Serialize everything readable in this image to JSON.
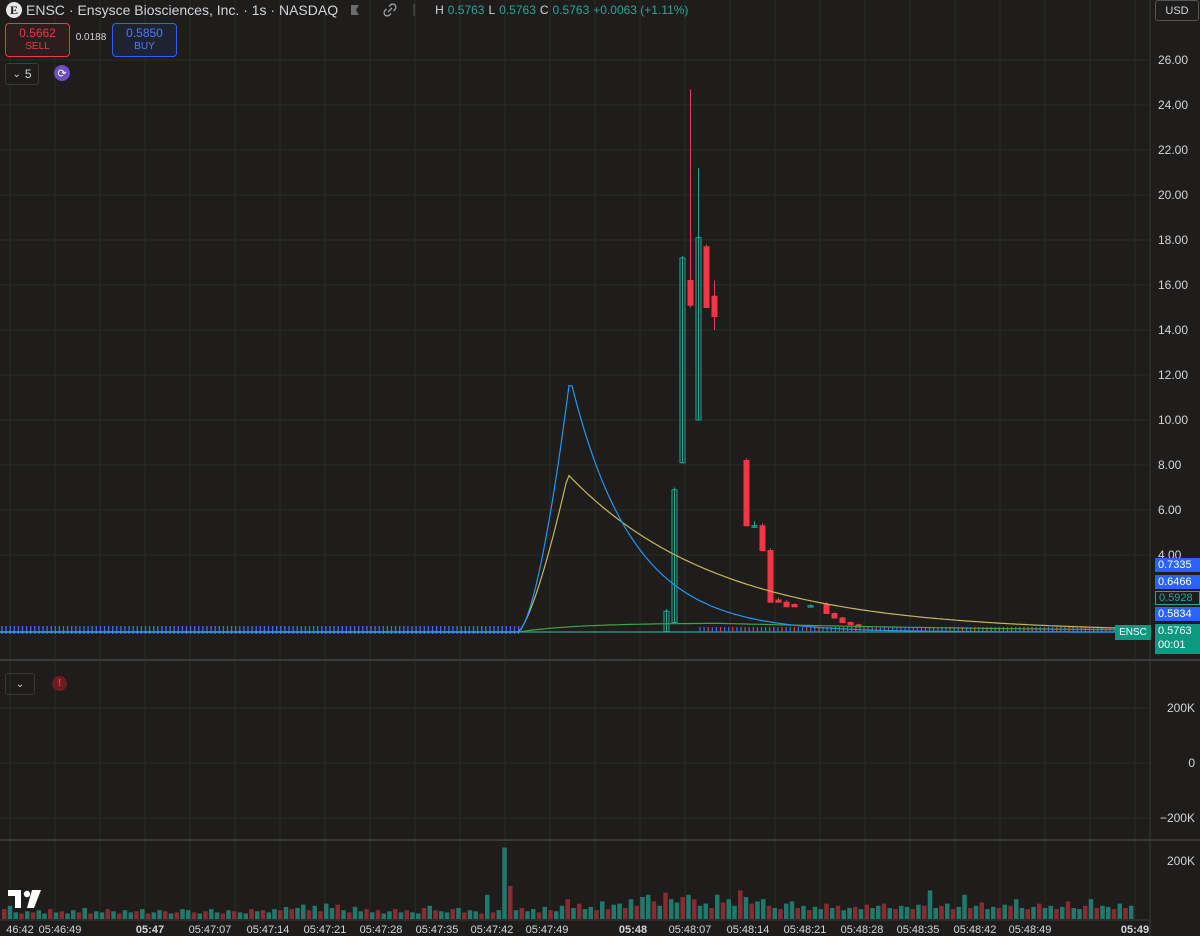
{
  "header": {
    "logo_letter": "E",
    "symbol": "ENSC",
    "title": "· Ensysce Biosciences, Inc. · 1s · NASDAQ",
    "ohlc": {
      "h_label": "H",
      "h": "0.5763",
      "l_label": "L",
      "l": "0.5763",
      "c_label": "C",
      "c": "0.5763",
      "change": "+0.0063 (+1.11%)"
    },
    "link_icon": "link-icon"
  },
  "trade": {
    "sell_price": "0.5662",
    "sell_label": "SELL",
    "spread": "0.0188",
    "buy_price": "0.5850",
    "buy_label": "BUY"
  },
  "interval": {
    "label": "5",
    "chevron": "⌄"
  },
  "currency": "USD",
  "price_axis": {
    "ticks": [
      "26.00",
      "24.00",
      "22.00",
      "20.00",
      "18.00",
      "16.00",
      "14.00",
      "12.00",
      "10.00",
      "8.00",
      "6.00",
      "4.00"
    ]
  },
  "price_tags": [
    {
      "value": "0.7335",
      "color": "#2962ff"
    },
    {
      "value": "0.6466",
      "color": "#2962ff"
    },
    {
      "value": "0.5928",
      "color": "#1e1d1b"
    },
    {
      "value": "0.5834",
      "color": "#2962ff"
    }
  ],
  "last_tag": {
    "symbol": "ENSC",
    "price": "0.5763",
    "countdown": "00:01"
  },
  "indicator_axis": {
    "ticks": [
      "200K",
      "0",
      "−200K"
    ]
  },
  "volume_axis": {
    "ticks": [
      "200K"
    ]
  },
  "time_axis": {
    "ticks": [
      "46:42",
      "05:46:49",
      "05:47",
      "05:47:07",
      "05:47:14",
      "05:47:21",
      "05:47:28",
      "05:47:35",
      "05:47:42",
      "05:47:49",
      "05:48",
      "05:48:07",
      "05:48:14",
      "05:48:21",
      "05:48:28",
      "05:48:35",
      "05:48:42",
      "05:48:49",
      "05:49"
    ]
  },
  "colors": {
    "up": "#26a69a",
    "down": "#f23645",
    "ma_blue": "#2196f3",
    "ma_yellow": "#c9b458",
    "ma_green": "#43a047"
  },
  "chart_data": {
    "type": "candlestick",
    "candles": [
      {
        "t": "05:47:44",
        "o": 0.6,
        "h": 1.6,
        "l": 0.58,
        "c": 1.5
      },
      {
        "t": "05:47:45",
        "o": 1.0,
        "h": 7.0,
        "l": 1.0,
        "c": 6.9
      },
      {
        "t": "05:47:46",
        "o": 8.1,
        "h": 17.3,
        "l": 8.1,
        "c": 17.2
      },
      {
        "t": "05:47:47",
        "o": 16.2,
        "h": 24.7,
        "l": 15.0,
        "c": 15.1
      },
      {
        "t": "05:47:48",
        "o": 10.0,
        "h": 21.2,
        "l": 10.0,
        "c": 18.1
      },
      {
        "t": "05:47:49",
        "o": 17.7,
        "h": 17.8,
        "l": 15.0,
        "c": 15.0
      },
      {
        "t": "05:47:50",
        "o": 15.5,
        "h": 16.2,
        "l": 14.0,
        "c": 14.6
      },
      {
        "t": "05:47:54",
        "o": 8.2,
        "h": 8.3,
        "l": 5.3,
        "c": 5.3
      },
      {
        "t": "05:47:55",
        "o": 5.3,
        "h": 5.5,
        "l": 5.2,
        "c": 5.3
      },
      {
        "t": "05:47:56",
        "o": 5.3,
        "h": 5.4,
        "l": 4.2,
        "c": 4.2
      },
      {
        "t": "05:47:57",
        "o": 4.2,
        "h": 4.3,
        "l": 1.9,
        "c": 1.9
      },
      {
        "t": "05:47:58",
        "o": 2.0,
        "h": 2.1,
        "l": 1.9,
        "c": 1.9
      },
      {
        "t": "05:47:59",
        "o": 1.9,
        "h": 2.0,
        "l": 1.7,
        "c": 1.7
      },
      {
        "t": "05:48:00",
        "o": 1.8,
        "h": 1.85,
        "l": 1.7,
        "c": 1.7
      },
      {
        "t": "05:48:02",
        "o": 1.7,
        "h": 1.8,
        "l": 1.7,
        "c": 1.75
      },
      {
        "t": "05:48:04",
        "o": 1.8,
        "h": 1.9,
        "l": 1.4,
        "c": 1.4
      },
      {
        "t": "05:48:05",
        "o": 1.4,
        "h": 1.45,
        "l": 1.2,
        "c": 1.2
      },
      {
        "t": "05:48:06",
        "o": 1.2,
        "h": 1.25,
        "l": 1.0,
        "c": 1.0
      },
      {
        "t": "05:48:07",
        "o": 1.0,
        "h": 1.05,
        "l": 0.9,
        "c": 0.9
      },
      {
        "t": "05:48:08",
        "o": 0.9,
        "h": 0.95,
        "l": 0.8,
        "c": 0.8
      }
    ],
    "tail_price": 0.5763,
    "ma_blue_peak": 11.3,
    "ma_yellow_peak": 7.0,
    "volume": [
      9,
      12,
      6,
      5,
      7,
      6,
      8,
      5,
      9,
      6,
      7,
      5,
      8,
      6,
      10,
      5,
      7,
      6,
      9,
      7,
      5,
      8,
      6,
      7,
      9,
      5,
      6,
      8,
      7,
      5,
      6,
      9,
      8,
      6,
      5,
      7,
      9,
      6,
      5,
      8,
      7,
      6,
      5,
      9,
      7,
      8,
      6,
      9,
      8,
      11,
      9,
      10,
      13,
      8,
      12,
      7,
      14,
      10,
      13,
      8,
      6,
      11,
      7,
      9,
      6,
      8,
      5,
      7,
      9,
      6,
      8,
      6,
      5,
      10,
      12,
      8,
      7,
      6,
      9,
      10,
      6,
      8,
      7,
      5,
      22,
      6,
      8,
      65,
      30,
      8,
      10,
      7,
      9,
      6,
      11,
      8,
      7,
      12,
      18,
      10,
      14,
      9,
      11,
      8,
      16,
      9,
      13,
      14,
      10,
      18,
      12,
      20,
      22,
      16,
      12,
      24,
      18,
      15,
      20,
      22,
      18,
      12,
      14,
      10,
      22,
      15,
      18,
      12,
      26,
      20,
      14,
      16,
      18,
      12,
      10,
      9,
      14,
      16,
      10,
      12,
      8,
      11,
      9,
      14,
      10,
      12,
      8,
      10,
      11,
      9,
      13,
      10,
      12,
      14,
      10,
      9,
      12,
      11,
      9,
      13,
      12,
      26,
      10,
      12,
      14,
      9,
      11,
      22,
      10,
      12,
      15,
      9,
      11,
      10,
      13,
      12,
      18,
      10,
      9,
      11,
      14,
      10,
      12,
      9,
      11,
      16,
      10,
      9,
      12,
      18,
      10,
      12,
      11,
      9,
      14,
      10,
      12
    ]
  }
}
